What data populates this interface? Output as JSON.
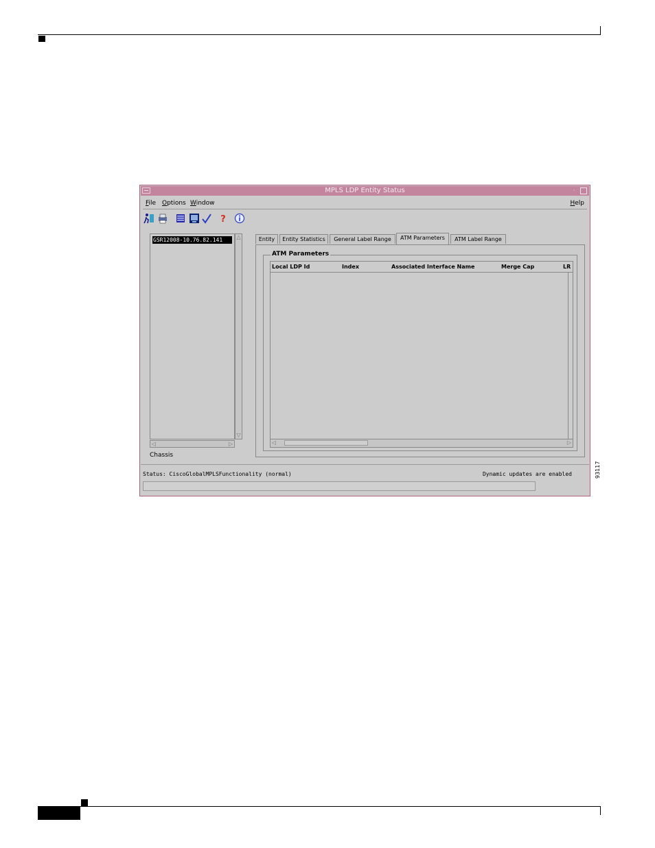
{
  "window": {
    "title": "MPLS LDP Entity Status"
  },
  "menubar": {
    "file": "File",
    "options": "Options",
    "window": "Window",
    "help": "Help"
  },
  "toolbar": {
    "icons": [
      "run-icon",
      "print-icon",
      "list-icon",
      "monitor-icon",
      "checkmark-icon",
      "help-icon",
      "info-icon"
    ]
  },
  "tree": {
    "selected_item": "GSR12008-10.76.82.141",
    "label": "Chassis"
  },
  "tabs": [
    {
      "label": "Entity"
    },
    {
      "label": "Entity Statistics"
    },
    {
      "label": "General Label Range"
    },
    {
      "label": "ATM Parameters"
    },
    {
      "label": "ATM Label Range"
    }
  ],
  "active_tab": "ATM Parameters",
  "group": {
    "title": "ATM Parameters"
  },
  "table": {
    "columns": [
      "Local LDP Id",
      "Index",
      "Associated Interface Name",
      "Merge Cap",
      "LR"
    ],
    "rows": []
  },
  "status": {
    "left": "Status: CiscoGlobalMPLSFunctionality (normal)",
    "right": "Dynamic updates are enabled"
  },
  "figure_number": "93117",
  "colors": {
    "titlebar": "#c2859d",
    "window_bg": "#cccccc",
    "border": "#b0607e"
  }
}
